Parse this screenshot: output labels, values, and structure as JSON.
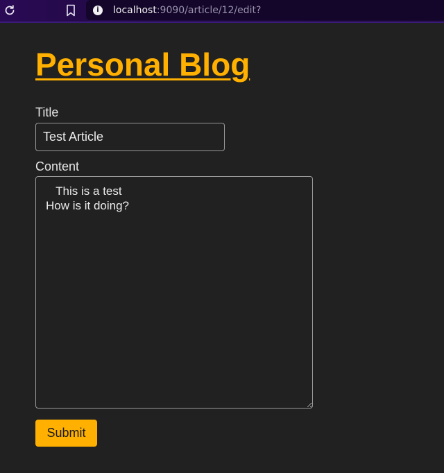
{
  "browser": {
    "url_host": "localhost",
    "url_path": ":9090/article/12/edit?",
    "reload_icon": "reload-icon",
    "bookmark_icon": "bookmark-icon",
    "info_icon": "info-icon",
    "info_glyph": "i"
  },
  "header": {
    "site_title": "Personal Blog"
  },
  "form": {
    "title_label": "Title",
    "title_value": "Test Article",
    "content_label": "Content",
    "content_value": "   This is a test\nHow is it doing?",
    "submit_label": "Submit"
  },
  "colors": {
    "accent": "#ffb000",
    "background": "#212121",
    "browser_bar": "#2a0a55"
  }
}
